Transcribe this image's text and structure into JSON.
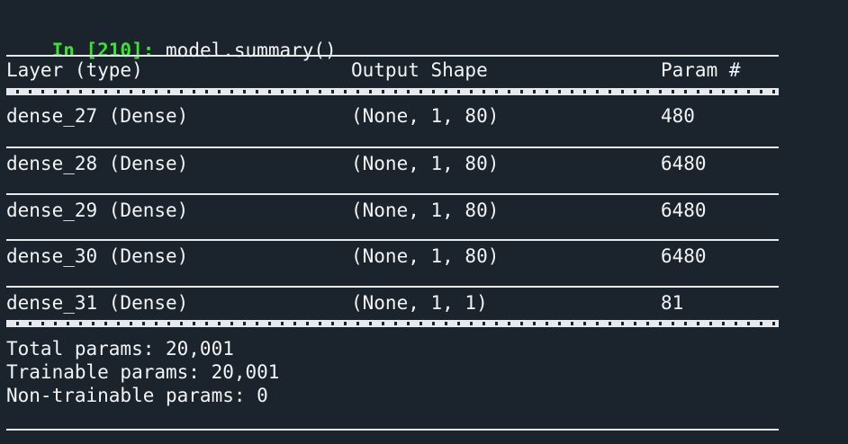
{
  "prompt": {
    "label": "In [210]:",
    "code": "model.summary()"
  },
  "table": {
    "headers": {
      "layer": "Layer (type)",
      "output": "Output Shape",
      "params": "Param #"
    },
    "rows": [
      {
        "layer": "dense_27 (Dense)",
        "output": "(None, 1, 80)",
        "params": "480"
      },
      {
        "layer": "dense_28 (Dense)",
        "output": "(None, 1, 80)",
        "params": "6480"
      },
      {
        "layer": "dense_29 (Dense)",
        "output": "(None, 1, 80)",
        "params": "6480"
      },
      {
        "layer": "dense_30 (Dense)",
        "output": "(None, 1, 80)",
        "params": "6480"
      },
      {
        "layer": "dense_31 (Dense)",
        "output": "(None, 1, 1)",
        "params": "81"
      }
    ]
  },
  "totals": {
    "total": "Total params: 20,001",
    "trainable": "Trainable params: 20,001",
    "non_trainable": "Non-trainable params: 0"
  },
  "colors": {
    "background": "#1b232d",
    "prompt": "#39e62f",
    "text": "#f2f4f6"
  }
}
